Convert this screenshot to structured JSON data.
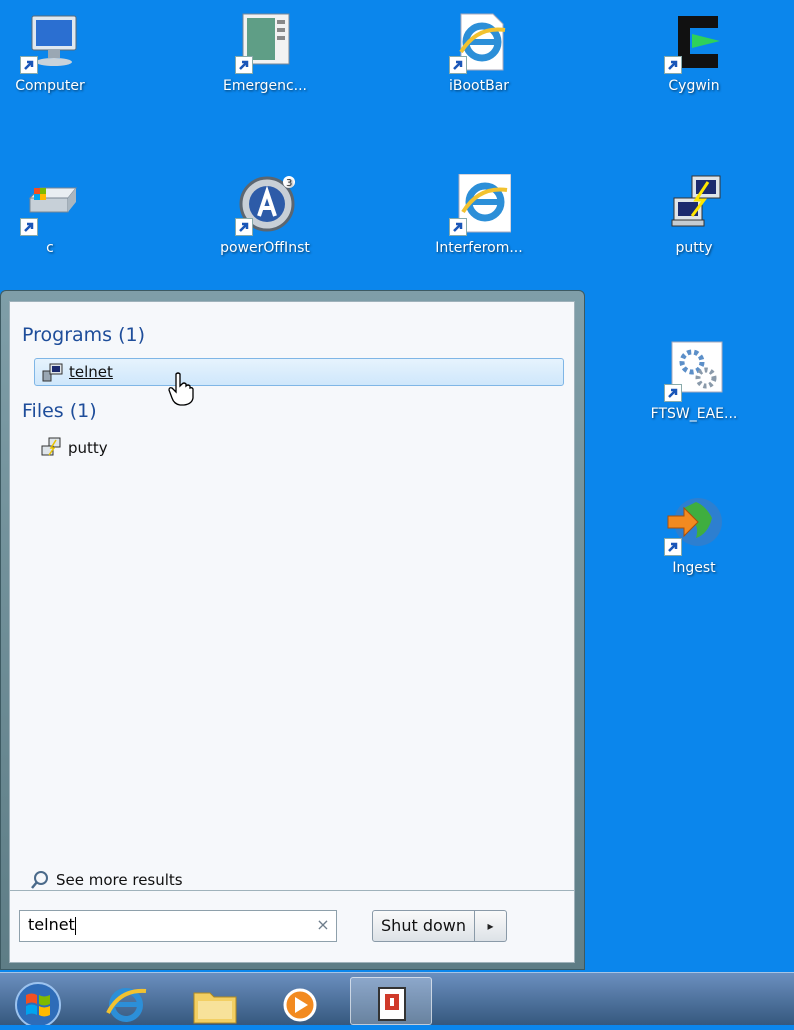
{
  "desktop": {
    "icons": [
      {
        "label": "Computer",
        "icon": "computer-icon"
      },
      {
        "label": "Emergenc...",
        "icon": "document-window-icon"
      },
      {
        "label": "iBootBar",
        "icon": "internet-explorer-icon"
      },
      {
        "label": "Cygwin",
        "icon": "cygwin-icon"
      },
      {
        "label": "c",
        "icon": "drive-icon"
      },
      {
        "label": "powerOffInst",
        "icon": "autoit-icon"
      },
      {
        "label": "Interferom...",
        "icon": "internet-explorer-icon"
      },
      {
        "label": "putty",
        "icon": "putty-icon"
      },
      {
        "label": "FTSW_EAE...",
        "icon": "settings-gears-icon"
      },
      {
        "label": "Ingest",
        "icon": "globe-arrow-icon"
      }
    ]
  },
  "start_menu": {
    "groups": [
      {
        "header": "Programs (1)",
        "items": [
          {
            "label": "telnet",
            "icon": "telnet-icon",
            "selected": true
          }
        ]
      },
      {
        "header": "Files (1)",
        "items": [
          {
            "label": "putty",
            "icon": "putty-icon",
            "selected": false
          }
        ]
      }
    ],
    "see_more_label": "See more results",
    "search": {
      "value": "telnet",
      "clear_glyph": "×"
    },
    "shutdown_label": "Shut down",
    "shutdown_arrow_glyph": "▸"
  },
  "taskbar": {
    "items": [
      "start-orb",
      "internet-explorer-icon",
      "file-explorer-icon",
      "media-player-icon",
      "active-window-icon"
    ]
  },
  "colors": {
    "desktop_bg": "#0b86ec",
    "selection": "#cfe7fb",
    "group_header": "#1e4d9a"
  }
}
